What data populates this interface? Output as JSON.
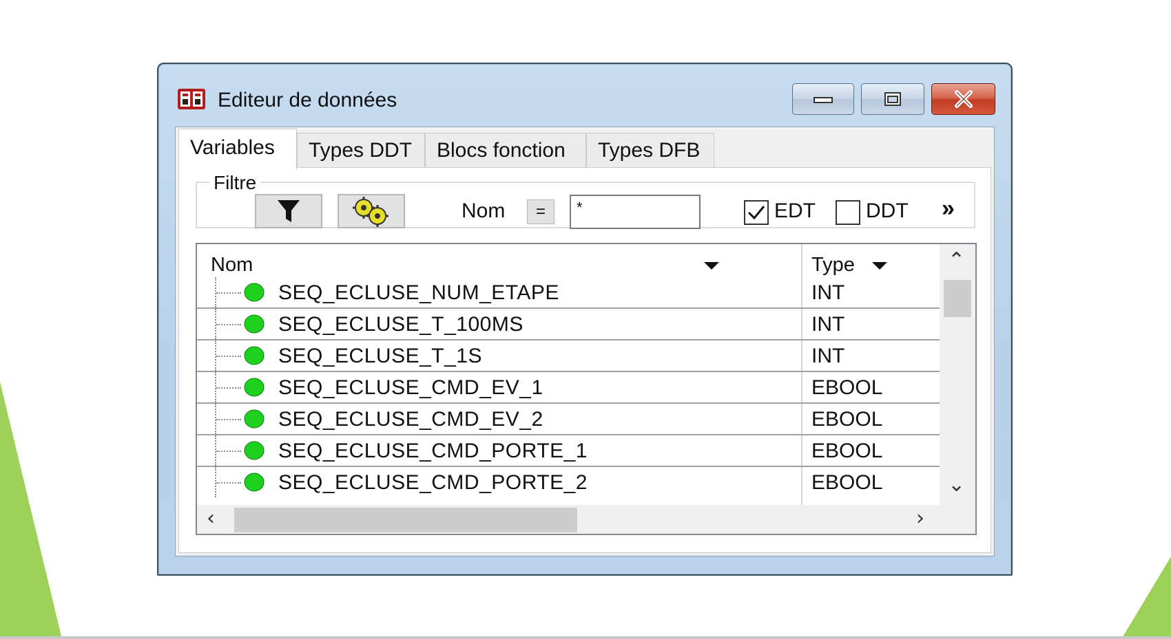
{
  "window": {
    "title": "Editeur de données"
  },
  "tabs": [
    {
      "label": "Variables"
    },
    {
      "label": "Types DDT"
    },
    {
      "label": "Blocs fonction"
    },
    {
      "label": "Types DFB"
    }
  ],
  "filter": {
    "group_label": "Filtre",
    "name_label": "Nom",
    "equals_label": "=",
    "name_value": "*",
    "edt": {
      "label": "EDT",
      "checked": true
    },
    "ddt": {
      "label": "DDT",
      "checked": false
    },
    "more_label": "»"
  },
  "table": {
    "columns": [
      {
        "label": "Nom"
      },
      {
        "label": "Type"
      }
    ],
    "rows": [
      {
        "name": "SEQ_ECLUSE_NUM_ETAPE",
        "type": "INT"
      },
      {
        "name": "SEQ_ECLUSE_T_100MS",
        "type": "INT"
      },
      {
        "name": "SEQ_ECLUSE_T_1S",
        "type": "INT"
      },
      {
        "name": "SEQ_ECLUSE_CMD_EV_1",
        "type": "EBOOL"
      },
      {
        "name": "SEQ_ECLUSE_CMD_EV_2",
        "type": "EBOOL"
      },
      {
        "name": "SEQ_ECLUSE_CMD_PORTE_1",
        "type": "EBOOL"
      },
      {
        "name": "SEQ_ECLUSE_CMD_PORTE_2",
        "type": "EBOOL"
      }
    ]
  },
  "colors": {
    "accent_green": "#9ed15a",
    "status_dot": "#1fd11f",
    "close_red": "#c8462d"
  },
  "icons": {
    "app": "data-editor-icon",
    "filter": "funnel-icon",
    "tools": "gears-icon"
  }
}
